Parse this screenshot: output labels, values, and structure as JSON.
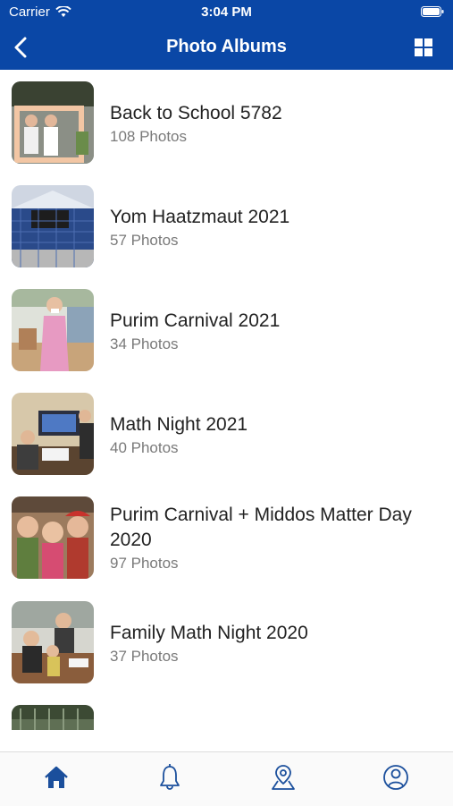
{
  "status_bar": {
    "carrier": "Carrier",
    "time": "3:04 PM"
  },
  "nav": {
    "title": "Photo Albums"
  },
  "albums": [
    {
      "title": "Back to School 5782",
      "count": "108 Photos"
    },
    {
      "title": "Yom Haatzmaut 2021",
      "count": "57 Photos"
    },
    {
      "title": "Purim Carnival 2021",
      "count": "34 Photos"
    },
    {
      "title": "Math Night 2021",
      "count": "40 Photos"
    },
    {
      "title": "Purim Carnival + Middos Matter Day 2020",
      "count": "97 Photos"
    },
    {
      "title": "Family Math Night 2020",
      "count": "37 Photos"
    }
  ],
  "tabs": [
    {
      "icon": "home-icon"
    },
    {
      "icon": "bell-icon"
    },
    {
      "icon": "map-pin-icon"
    },
    {
      "icon": "user-icon"
    }
  ],
  "colors": {
    "brand": "#0a47a6",
    "tab_icon": "#1b4f9c",
    "subtitle": "#7a7a7a"
  }
}
